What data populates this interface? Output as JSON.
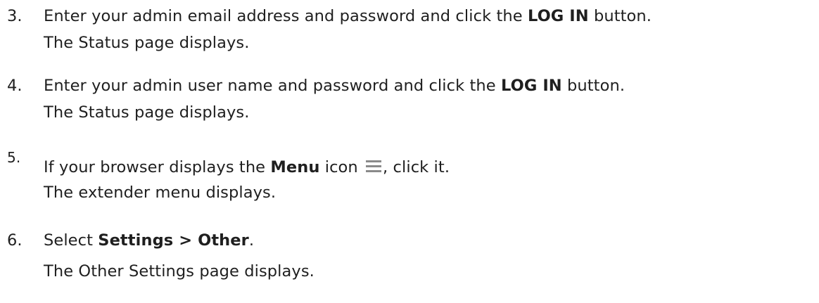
{
  "steps": [
    {
      "number": "3.",
      "line1_before": "Enter your admin email address and password and click the ",
      "line1_bold": "LOG IN",
      "line1_after": " button.",
      "line2": "The Status page displays."
    },
    {
      "number": "4.",
      "line1_before": "Enter your admin user name and password and click the ",
      "line1_bold": "LOG IN",
      "line1_after": " button.",
      "line2": "The Status page displays."
    },
    {
      "number": "5.",
      "line1_before": "If your browser displays the ",
      "line1_bold": "Menu",
      "line1_mid": " icon ",
      "icon": "menu-icon",
      "line1_after": ", click it.",
      "line2": "The extender menu displays."
    },
    {
      "number": "6.",
      "line1_before": "Select ",
      "line1_bold": "Settings > Other",
      "line1_after": ".",
      "line2": "The Other Settings page displays."
    }
  ]
}
